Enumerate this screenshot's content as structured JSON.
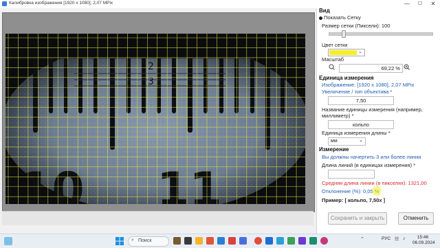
{
  "window": {
    "title": "Калибровка изображения [1920 x 1080], 2,07 MPix",
    "minimize": "—",
    "maximize": "☐",
    "close": "✕"
  },
  "ruler_labels": [
    "1",
    "2",
    "3",
    "10",
    "11"
  ],
  "panel": {
    "view_header": "Вид",
    "show_grid_label": "Показать Сетку",
    "show_grid_checked": true,
    "grid_size_label": "Размер сетки (Пиксели): 100",
    "grid_size_value": 100,
    "grid_color_label": "Цвет сетки",
    "grid_color": "#f4ee2a",
    "zoom_label": "Масштаб",
    "zoom_value": "69,22 %",
    "measure_unit_header": "Единица измерения",
    "image_info": "Изображение: [1920 x 1080], 2,07 MPix",
    "magnification_label": "Увеличение / тип объектива *",
    "magnification_value": "7,50",
    "unit_name_label_1": "Название единицы измерения (например,",
    "unit_name_label_2": "миллиметр) *",
    "unit_name_value": "кольпо",
    "length_unit_label": "Единица измерения длины *",
    "length_unit_value": "мм",
    "measurement_header": "Измерение",
    "start_hint": "Вы должны начертить 3 или более линии",
    "line_length_label": "Длина линий (в единицах измерения) *",
    "line_length_value": "",
    "avg_length": "Средняя длина линии (в пикселях): 1321,00",
    "deviation": "Отклонение (%): 0,05 %",
    "example": "Пример:  [ кольпо, 7,50x ]",
    "save_button": "Сохранить и закрыть",
    "cancel_button": "Отменить"
  },
  "taskbar": {
    "search_placeholder": "Поиск",
    "lang": "РУС",
    "time": "15:46",
    "date": "06.09.2024"
  }
}
